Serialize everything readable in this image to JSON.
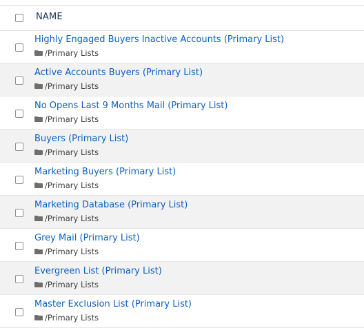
{
  "header": {
    "column_label": "NAME"
  },
  "icons": {
    "folder": "folder-icon",
    "checkbox": "checkbox"
  },
  "colors": {
    "link": "#0b5fc4",
    "alt_row": "#f3f2f2",
    "header_text": "#16325c"
  },
  "rows": [
    {
      "name": "Highly Engaged Buyers Inactive Accounts (Primary List)",
      "folder": "/Primary Lists"
    },
    {
      "name": "Active Accounts Buyers (Primary List)",
      "folder": "/Primary Lists"
    },
    {
      "name": "No Opens Last 9 Months Mail (Primary List)",
      "folder": "/Primary Lists"
    },
    {
      "name": "Buyers (Primary List)",
      "folder": "/Primary Lists"
    },
    {
      "name": "Marketing Buyers (Primary List)",
      "folder": "/Primary Lists"
    },
    {
      "name": "Marketing Database (Primary List)",
      "folder": "/Primary Lists"
    },
    {
      "name": "Grey Mail (Primary List)",
      "folder": "/Primary Lists"
    },
    {
      "name": "Evergreen List (Primary List)",
      "folder": "/Primary Lists"
    },
    {
      "name": "Master Exclusion List (Primary List)",
      "folder": "/Primary Lists"
    }
  ]
}
